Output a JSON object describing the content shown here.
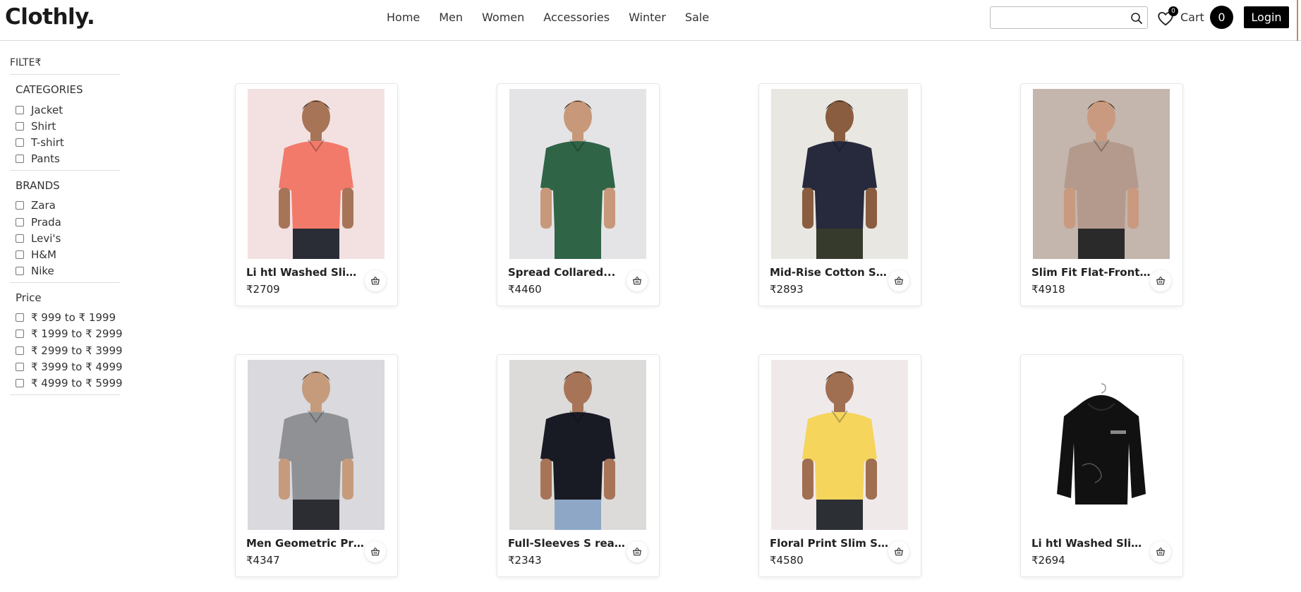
{
  "brand": {
    "logo": "Clothly."
  },
  "nav": [
    {
      "label": "Home"
    },
    {
      "label": "Men"
    },
    {
      "label": "Women"
    },
    {
      "label": "Accessories"
    },
    {
      "label": "Winter"
    },
    {
      "label": "Sale"
    }
  ],
  "search": {
    "placeholder": "",
    "icon": "search-icon"
  },
  "wishlist": {
    "count": "0",
    "icon": "heart-icon"
  },
  "cart": {
    "label": "Cart",
    "count": "0"
  },
  "login": {
    "label": "Login"
  },
  "filters": {
    "title": "FILTE₹",
    "categories": {
      "title": "CATEGORIES",
      "options": [
        "Jacket",
        "Shirt",
        "T-shirt",
        "Pants"
      ]
    },
    "brands": {
      "title": "BRANDS",
      "options": [
        "Zara",
        "Prada",
        "Levi's",
        "H&M",
        "Nike"
      ]
    },
    "price": {
      "title": "Price",
      "options": [
        "₹ 999 to ₹ 1999",
        "₹ 1999 to ₹ 2999",
        "₹ 2999 to ₹ 3999",
        "₹ 3999 to ₹ 4999",
        "₹ 4999 to ₹ 5999"
      ]
    }
  },
  "products": [
    {
      "name": "Li htl Washed Slim F...",
      "price": "₹2709",
      "bg": "#f3e1e1",
      "shirt": "#f27a6b",
      "pants": "#2a2d36",
      "skin": "#a87458"
    },
    {
      "name": "Spread Collared...",
      "price": "₹4460",
      "bg": "#e4e4e6",
      "shirt": "#2f6447",
      "pants": "#2f6447",
      "skin": "#c8987a"
    },
    {
      "name": "Mid-Rise Cotton Sli...",
      "price": "₹2893",
      "bg": "#e9e7e2",
      "shirt": "#272a3d",
      "pants": "#353a2c",
      "skin": "#8a5d40"
    },
    {
      "name": "Slim Fit Flat-Front...",
      "price": "₹4918",
      "bg": "#c4b5ad",
      "shirt": "#b49a8d",
      "pants": "#2a2a2a",
      "skin": "#c99a7f"
    },
    {
      "name": "Men Geometric Prin...",
      "price": "₹4347",
      "bg": "#d9d9de",
      "shirt": "#8f9194",
      "pants": "#2b2d33",
      "skin": "#c69b7c"
    },
    {
      "name": "Full-Sleeves S read...",
      "price": "₹2343",
      "bg": "#dcdbd9",
      "shirt": "#181a24",
      "pants": "#8ea7c6",
      "skin": "#a87458"
    },
    {
      "name": "Floral Print Slim Shir...",
      "price": "₹4580",
      "bg": "#efe9ea",
      "shirt": "#f5d55c",
      "pants": "#2c2f33",
      "skin": "#a06e50"
    },
    {
      "name": "Li htl Washed Slim F...",
      "price": "₹2694",
      "bg": "#ffffff",
      "shirt": "#111111",
      "pants": "#111111",
      "skin": "#ffffff"
    }
  ]
}
